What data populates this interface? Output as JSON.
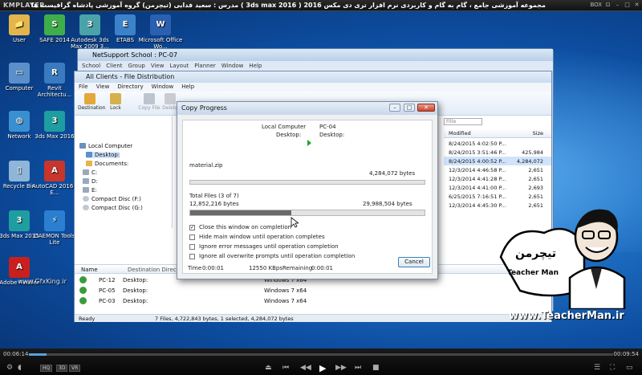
{
  "player": {
    "logo": "KMPLAYER",
    "title": "مجموعه آموزشی جامع ، گام به گام و کاربردی نرم افزار تری دی مکس 2016 ( 3ds max 2016 ) مدرس : سعید فدایی (تیچرمن) گروه آموزشی پادشاه گرافیست ها",
    "btn_box": "BOX",
    "time_current": "00:06:14",
    "time_total": "00:09:54",
    "progress_fraction": 0.03,
    "ctl_1": "HQ",
    "ctl_2": "3D",
    "ctl_3": "VR"
  },
  "desktop_icons": [
    {
      "label": "User",
      "color": "#e3b54a",
      "glyph": "📁"
    },
    {
      "label": "SAFE 2014",
      "color": "#3fae4a",
      "glyph": "S"
    },
    {
      "label": "Autodesk 3ds Max 2009 3...",
      "color": "#4aa3a8",
      "glyph": "3"
    },
    {
      "label": "ETABS",
      "color": "#3c82c8",
      "glyph": "E"
    },
    {
      "label": "Microsoft Office Wo...",
      "color": "#2b5fb0",
      "glyph": "W"
    },
    {
      "label": "Computer",
      "color": "#5b8fc9",
      "glyph": "▭"
    },
    {
      "label": "Revit Architectu...",
      "color": "#3a7bbf",
      "glyph": "R"
    },
    {
      "label": "Network",
      "color": "#3a8fd0",
      "glyph": "◍"
    },
    {
      "label": "3ds Max 2016",
      "color": "#1e9ea0",
      "glyph": "3"
    },
    {
      "label": "Recycle Bin",
      "color": "#8fb5d8",
      "glyph": "▯"
    },
    {
      "label": "AutoCAD 2016 - E...",
      "color": "#c8352b",
      "glyph": "A"
    },
    {
      "label": "3ds Max 2015",
      "color": "#1e9ea0",
      "glyph": "3"
    },
    {
      "label": "DAEMON Tools Lite",
      "color": "#2a7fd0",
      "glyph": "⚡"
    },
    {
      "label": "Adobe Reader",
      "color": "#c8201e",
      "glyph": "A"
    }
  ],
  "netsupport": {
    "title": "NetSupport School : PC-07",
    "menu": [
      "School",
      "Client",
      "Group",
      "View",
      "Layout",
      "Planner",
      "Window",
      "Help"
    ]
  },
  "file_dist": {
    "title": "All Clients - File Distribution",
    "menu": [
      "File",
      "View",
      "Directory",
      "Window",
      "Help"
    ],
    "toolbar": [
      "Destination",
      "Lock",
      "Copy File",
      "Delete"
    ],
    "tree": [
      "Local Computer",
      "Desktop:",
      "Documents:",
      "C:",
      "D:",
      "E:",
      "Compact Disc (F:)",
      "Compact Disc (G:)"
    ],
    "right_header": {
      "modified": "Modified",
      "size": "Size",
      "filter": "Filte"
    },
    "right_rows": [
      {
        "date": "8/24/2015 4:02:50 P...",
        "size": ""
      },
      {
        "date": "8/24/2015 3:51:46 P...",
        "size": "425,984"
      },
      {
        "date": "8/24/2015 4:00:52 P...",
        "size": "4,284,072"
      },
      {
        "date": "12/3/2014 4:46:58 P...",
        "size": "2,651"
      },
      {
        "date": "12/3/2014 4:41:28 P...",
        "size": "2,651"
      },
      {
        "date": "12/3/2014 4:41:00 P...",
        "size": "2,693"
      },
      {
        "date": "6/25/2015 7:16:51 P...",
        "size": "2,651"
      },
      {
        "date": "12/3/2014 4:45:30 P...",
        "size": "2,651"
      }
    ],
    "bottom_header": {
      "name": "Name",
      "dir": "Destination Directory"
    },
    "bottom_rows": [
      {
        "name": "PC-12",
        "dir": "Desktop:",
        "os": "Windows 7 x64"
      },
      {
        "name": "PC-05",
        "dir": "Desktop:",
        "os": "Windows 7 x64"
      },
      {
        "name": "PC-03",
        "dir": "Desktop:",
        "os": "Windows 7 x64"
      }
    ],
    "status_ready": "Ready",
    "status_info": "7 Files, 4,722,843 bytes, 1 selected, 4,284,072 bytes"
  },
  "copy_progress": {
    "title": "Copy Progress",
    "src_label": "Local Computer",
    "src_dir": "Desktop:",
    "dst_label": "PC-04",
    "dst_dir": "Desktop:",
    "file_name": "material.zip",
    "file_bytes": "4,284,072 bytes",
    "file_fraction": 0.0,
    "total_label": "Total Files (3 of 7)",
    "total_done": "12,852,216 bytes",
    "total_bytes": "29,988,504 bytes",
    "total_fraction": 0.43,
    "options": [
      {
        "label": "Close this window on completion",
        "checked": true
      },
      {
        "label": "Hide main window until operation completes",
        "checked": false
      },
      {
        "label": "Ignore error messages until operation completion",
        "checked": false
      },
      {
        "label": "Ignore all overwrite prompts until operation completion",
        "checked": false
      }
    ],
    "time_label": "Time",
    "time_value": "0:00:01",
    "speed": "12550 KBps",
    "remaining_label": "Remaining",
    "remaining_value": "0:00:01",
    "cancel": "Cancel"
  },
  "watermarks": {
    "left": "www.GfxKing.ir",
    "right": "www.TeacherMan.ir",
    "badge_name": "Teacher Man",
    "badge_fa": "تیچرمن"
  }
}
